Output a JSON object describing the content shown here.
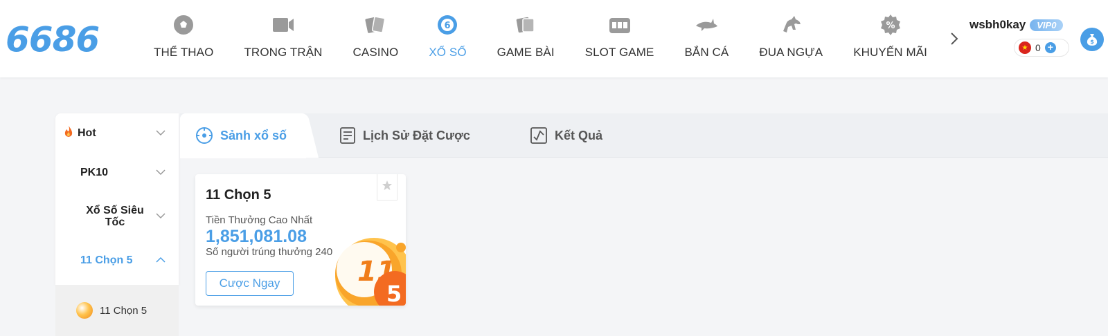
{
  "header": {
    "logo": "6686",
    "nav": [
      {
        "label": "THỂ THAO",
        "icon": "soccer-ball-icon",
        "active": false
      },
      {
        "label": "TRONG TRẬN",
        "icon": "video-camera-icon",
        "active": false
      },
      {
        "label": "CASINO",
        "icon": "playing-cards-icon",
        "active": false
      },
      {
        "label": "XỔ SỐ",
        "icon": "lottery-ball-icon",
        "active": true
      },
      {
        "label": "GAME BÀI",
        "icon": "card-game-icon",
        "active": false
      },
      {
        "label": "SLOT GAME",
        "icon": "slot-machine-icon",
        "active": false
      },
      {
        "label": "BẮN CÁ",
        "icon": "shark-icon",
        "active": false
      },
      {
        "label": "ĐUA NGỰA",
        "icon": "horse-icon",
        "active": false
      },
      {
        "label": "KHUYẾN MÃI",
        "icon": "percent-icon",
        "active": false
      }
    ],
    "user": {
      "username": "wsbh0kay",
      "vip": "VIP0",
      "balance": "0"
    }
  },
  "sidebar": {
    "items": [
      {
        "label": "Hot",
        "icon": "fire-icon",
        "expanded": false,
        "active": false
      },
      {
        "label": "PK10",
        "expanded": false,
        "active": false
      },
      {
        "label": "Xổ Số Siêu Tốc",
        "expanded": false,
        "active": false
      },
      {
        "label": "11 Chọn 5",
        "expanded": true,
        "active": true
      }
    ],
    "sub_items": [
      {
        "label": "11 Chọn 5",
        "icon": "lottery-ball-icon"
      }
    ]
  },
  "tabs": [
    {
      "label": "Sảnh xổ số",
      "icon": "lottery-hall-icon",
      "active": true
    },
    {
      "label": "Lịch Sử Đặt Cược",
      "icon": "document-list-icon",
      "active": false
    },
    {
      "label": "Kết Quả",
      "icon": "chart-result-icon",
      "active": false
    }
  ],
  "game_card": {
    "title": "11 Chọn 5",
    "prize_label": "Tiền Thưởng Cao Nhất",
    "prize_value": "1,851,081.08",
    "winners_text": "Số người trúng thưởng 240",
    "bet_button": "Cược Ngay",
    "ball_numbers": [
      "11",
      "5"
    ]
  },
  "colors": {
    "accent": "#4a9ee6",
    "ball_orange": "#f08a1c"
  }
}
